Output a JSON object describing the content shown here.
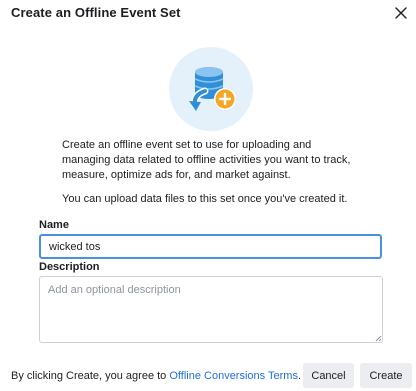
{
  "dialog": {
    "title": "Create an Offline Event Set",
    "close_icon": "close-icon"
  },
  "illustration": {
    "icon": "database-add-icon",
    "colors": {
      "circle": "#e4f1fb",
      "database": "#2f8fd8",
      "arrow": "#2f8fd8",
      "plus_badge": "#f5a623"
    }
  },
  "description": {
    "paragraph1": "Create an offline event set to use for uploading and managing data related to offline activities you want to track, measure, optimize ads for, and market against.",
    "paragraph2": "You can upload data files to this set once you've created it."
  },
  "form": {
    "name_label": "Name",
    "name_value": "wicked tos",
    "description_label": "Description",
    "description_placeholder": "Add an optional description"
  },
  "footer": {
    "terms_prefix": "By clicking Create, you agree to ",
    "terms_link": "Offline Conversions Terms",
    "terms_suffix": ".",
    "cancel_label": "Cancel",
    "create_label": "Create"
  },
  "colors": {
    "focus_border": "#4a90e2",
    "link": "#216fdb",
    "button_bg": "#ebedf0"
  }
}
